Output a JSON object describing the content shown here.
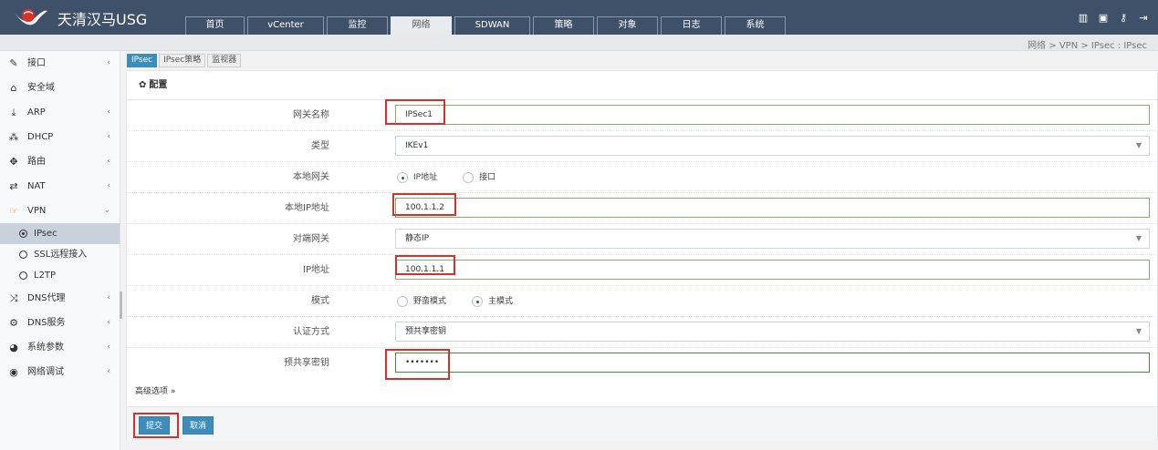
{
  "app": {
    "brand": "天清汉马USG",
    "logo_icon": "venus-logo-icon"
  },
  "nav_tabs": [
    "首页",
    "vCenter",
    "监控",
    "网络",
    "SDWAN",
    "策略",
    "对象",
    "日志",
    "系统"
  ],
  "nav_active": "网络",
  "top_icons": [
    "book-icon",
    "save-icon",
    "key-icon",
    "logout-icon"
  ],
  "breadcrumb": "网络 > VPN > IPsec : IPsec",
  "sidebar": {
    "items": [
      {
        "label": "接口",
        "icon": "plug-icon"
      },
      {
        "label": "安全域",
        "icon": "bank-icon"
      },
      {
        "label": "ARP",
        "icon": "download-icon"
      },
      {
        "label": "DHCP",
        "icon": "network-icon"
      },
      {
        "label": "路由",
        "icon": "arrows-icon"
      },
      {
        "label": "NAT",
        "icon": "exchange-icon"
      },
      {
        "label": "VPN",
        "icon": "hand-icon"
      },
      {
        "label": "DNS代理",
        "icon": "random-icon"
      },
      {
        "label": "DNS服务",
        "icon": "cogs-icon"
      },
      {
        "label": "系统参数",
        "icon": "globe-icon"
      },
      {
        "label": "网络调试",
        "icon": "target-icon"
      }
    ],
    "vpn_sub": [
      {
        "label": "IPsec",
        "active": true
      },
      {
        "label": "SSL远程接入",
        "active": false
      },
      {
        "label": "L2TP",
        "active": false
      }
    ]
  },
  "subtabs": [
    {
      "label": "IPsec",
      "active": true
    },
    {
      "label": "IPsec策略",
      "active": false
    },
    {
      "label": "监视器",
      "active": false
    }
  ],
  "panel": {
    "title": "配置",
    "fields": {
      "gateway_name": {
        "label": "网关名称",
        "value": "IPSec1"
      },
      "type": {
        "label": "类型",
        "value": "IKEv1"
      },
      "local_gateway": {
        "label": "本地网关",
        "options": [
          "IP地址",
          "接口"
        ],
        "selected": "IP地址"
      },
      "local_ip": {
        "label": "本地IP地址",
        "value": "100.1.1.2"
      },
      "peer_gateway": {
        "label": "对端网关",
        "value": "静态IP"
      },
      "ip_address": {
        "label": "IP地址",
        "value": "100.1.1.1"
      },
      "mode": {
        "label": "模式",
        "options": [
          "野蛮模式",
          "主模式"
        ],
        "selected": "主模式"
      },
      "auth_method": {
        "label": "认证方式",
        "value": "预共享密钥"
      },
      "psk": {
        "label": "预共享密钥",
        "value": "•••••••"
      }
    },
    "advanced_link": "高级选项 »",
    "submit_label": "提交",
    "cancel_label": "取消"
  },
  "colors": {
    "topbar": "#3f5168",
    "accent": "#3c8dbc",
    "highlight_box": "#d9312a",
    "vpn_icon": "#e8923a"
  }
}
